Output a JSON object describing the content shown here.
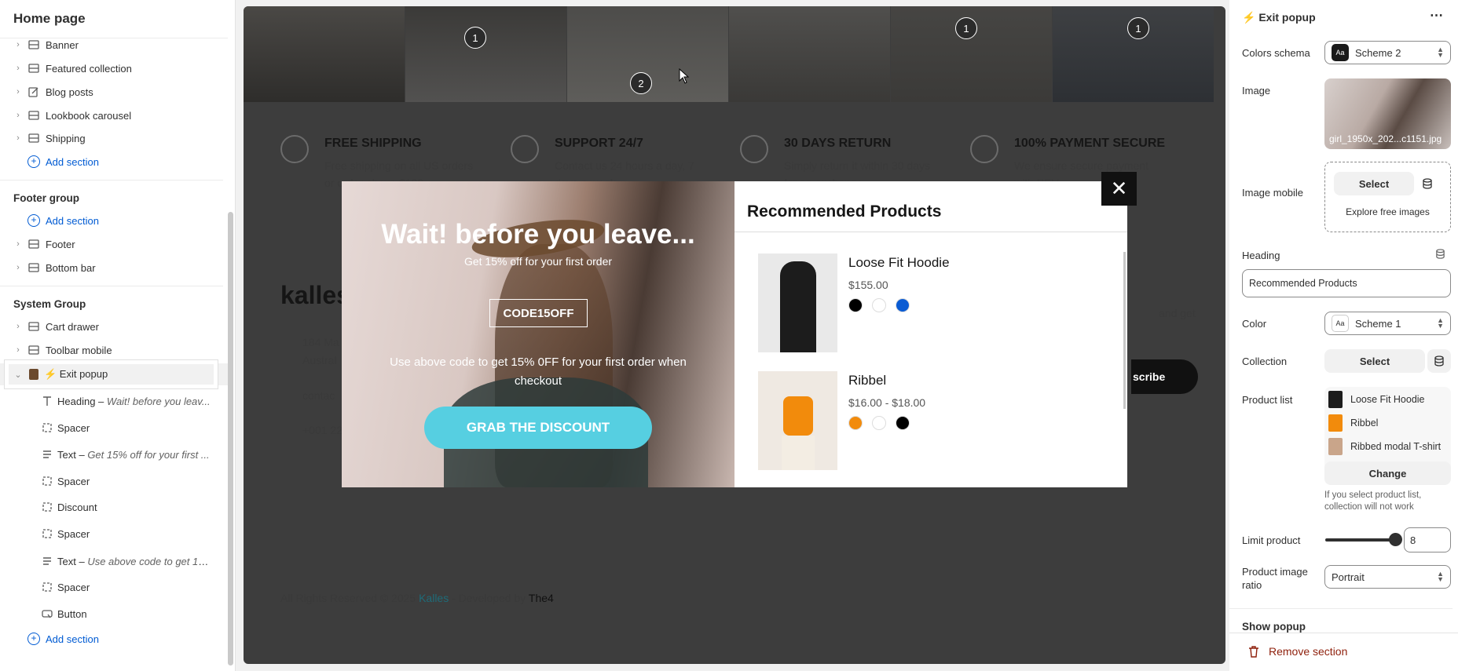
{
  "sidebar": {
    "title": "Home page",
    "header_sections": [
      "Banner",
      "Featured collection",
      "Blog posts",
      "Lookbook carousel",
      "Shipping"
    ],
    "add_section": "Add section",
    "footer_group": {
      "title": "Footer group",
      "add_section": "Add section",
      "items": [
        "Footer",
        "Bottom bar"
      ]
    },
    "system_group": {
      "title": "System Group",
      "items": [
        "Cart drawer",
        "Toolbar mobile",
        "⚡ Exit popup"
      ],
      "children": [
        {
          "label": "Heading",
          "detail": "Wait! before you leav..."
        },
        {
          "label": "Spacer",
          "detail": ""
        },
        {
          "label": "Text",
          "detail": "Get 15% off for your first ..."
        },
        {
          "label": "Spacer",
          "detail": ""
        },
        {
          "label": "Discount",
          "detail": ""
        },
        {
          "label": "Spacer",
          "detail": ""
        },
        {
          "label": "Text",
          "detail": "Use above code to get 15..."
        },
        {
          "label": "Spacer",
          "detail": ""
        },
        {
          "label": "Button",
          "detail": ""
        }
      ],
      "add_section": "Add section"
    }
  },
  "preview": {
    "lookbook_dots": [
      "1",
      "2",
      "1",
      "1"
    ],
    "features": [
      {
        "title": "FREE SHIPPING",
        "text": "Free shipping on all US orders",
        "text2": "or order above $100"
      },
      {
        "title": "SUPPORT 24/7",
        "text": "Contact us 24 hours a day, 7",
        "text2": "days a week"
      },
      {
        "title": "30 DAYS RETURN",
        "text": "Simply return it within 30 days",
        "text2": "for an exchange."
      },
      {
        "title": "100% PAYMENT SECURE",
        "text": "We ensure secure payment",
        "text2": "with PEV"
      }
    ],
    "footer": {
      "logo": "kalles",
      "address": "184 Ma",
      "address2": "Austral",
      "contact": "contac",
      "phone": "+001 22",
      "newsletter_tail": "and get",
      "subscribe_tail": "scribe",
      "copyright_prefix": "All Rights Reserved © 2025 ",
      "brand": "Kalles",
      "developed": " - Developed by ",
      "dev": "The4"
    }
  },
  "popup": {
    "heading": "Wait! before you leave...",
    "subheading": "Get 15% off for your first order",
    "code": "CODE15OFF",
    "description": "Use above code to get 15% 0FF for your first order when checkout",
    "button": "GRAB THE DISCOUNT",
    "close": "✕",
    "recommended_title": "Recommended Products",
    "products": [
      {
        "name": "Loose Fit Hoodie",
        "price": "$155.00",
        "swatches": [
          "#000000",
          "#ffffff",
          "#0a5bd3"
        ]
      },
      {
        "name": "Ribbel",
        "price": "$16.00 - $18.00",
        "swatches": [
          "#f28b0c",
          "#ffffff",
          "#000000"
        ]
      }
    ]
  },
  "panel": {
    "title": "⚡ Exit popup",
    "more": "⋯",
    "colors_schema_label": "Colors schema",
    "colors_schema_value": "Scheme 2",
    "image_label": "Image",
    "image_filename": "girl_1950x_202...c1151.jpg",
    "image_mobile_label": "Image mobile",
    "select": "Select",
    "explore": "Explore free images",
    "heading_label": "Heading",
    "heading_value": "Recommended Products",
    "color_label": "Color",
    "color_value": "Scheme 1",
    "collection_label": "Collection",
    "collection_select": "Select",
    "product_list_label": "Product list",
    "product_list": [
      "Loose Fit Hoodie",
      "Ribbel",
      "Ribbed modal T-shirt"
    ],
    "change": "Change",
    "help": "If you select product list, collection will not work",
    "limit_label": "Limit product",
    "limit_value": "8",
    "ratio_label": "Product image ratio",
    "ratio_value": "Portrait",
    "show_popup": "Show popup",
    "remove": "Remove section"
  }
}
